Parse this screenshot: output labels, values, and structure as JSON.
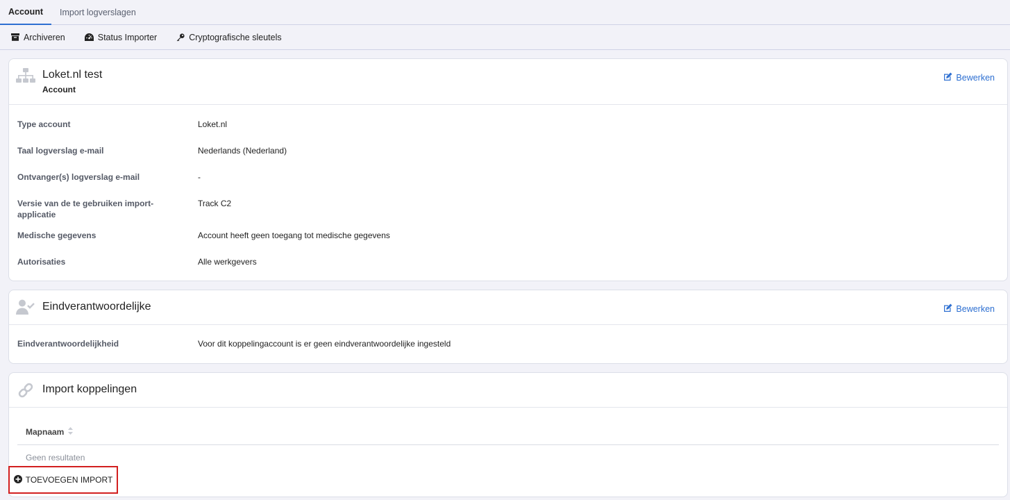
{
  "tabs": [
    {
      "label": "Account",
      "active": true
    },
    {
      "label": "Import logverslagen",
      "active": false
    }
  ],
  "toolbar": {
    "archive_label": "Archiveren",
    "status_label": "Status Importer",
    "keys_label": "Cryptografische sleutels"
  },
  "account": {
    "title": "Loket.nl test",
    "subtitle": "Account",
    "edit_label": "Bewerken",
    "fields": [
      {
        "label": "Type account",
        "value": "Loket.nl"
      },
      {
        "label": "Taal logverslag e-mail",
        "value": "Nederlands (Nederland)"
      },
      {
        "label": "Ontvanger(s) logverslag e-mail",
        "value": "-"
      },
      {
        "label": "Versie van de te gebruiken import-applicatie",
        "value": "Track C2"
      },
      {
        "label": "Medische gegevens",
        "value": "Account heeft geen toegang tot medische gegevens"
      },
      {
        "label": "Autorisaties",
        "value": "Alle werkgevers"
      }
    ]
  },
  "responsible": {
    "title": "Eindverantwoordelijke",
    "edit_label": "Bewerken",
    "fields": [
      {
        "label": "Eindverantwoordelijkheid",
        "value": "Voor dit koppelingaccount is er geen eindverantwoordelijke ingesteld"
      }
    ]
  },
  "imports": {
    "title": "Import koppelingen",
    "column_header": "Mapnaam",
    "empty_text": "Geen resultaten",
    "add_label": "TOEVOEGEN IMPORT"
  },
  "colors": {
    "accent": "#2d6fd1",
    "highlight_border": "#d21f1f",
    "page_bg": "#f2f2f8"
  }
}
